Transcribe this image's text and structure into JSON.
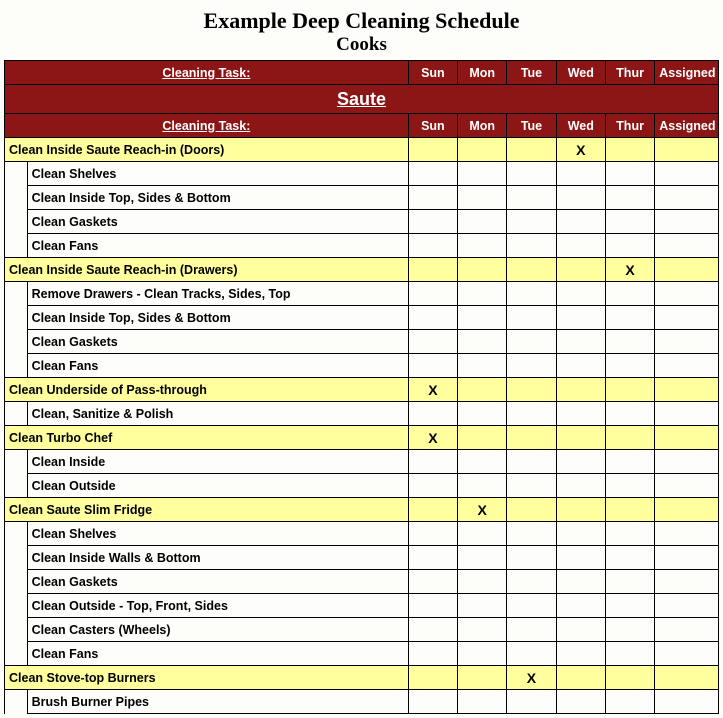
{
  "title": "Example Deep Cleaning Schedule",
  "subtitle": "Cooks",
  "columns": {
    "task": "Cleaning Task:",
    "sun": "Sun",
    "mon": "Mon",
    "tue": "Tue",
    "wed": "Wed",
    "thur": "Thur",
    "assigned": "Assigned"
  },
  "section": "Saute",
  "rows": [
    {
      "type": "main",
      "label": "Clean Inside Saute Reach-in (Doors)",
      "marks": {
        "wed": "X"
      }
    },
    {
      "type": "sub",
      "label": "Clean Shelves"
    },
    {
      "type": "sub",
      "label": "Clean Inside Top, Sides & Bottom"
    },
    {
      "type": "sub",
      "label": "Clean Gaskets"
    },
    {
      "type": "sub",
      "label": "Clean Fans"
    },
    {
      "type": "main",
      "label": "Clean Inside Saute Reach-in (Drawers)",
      "marks": {
        "thur": "X"
      }
    },
    {
      "type": "sub",
      "label": "Remove Drawers - Clean Tracks, Sides, Top"
    },
    {
      "type": "sub",
      "label": "Clean Inside Top, Sides & Bottom"
    },
    {
      "type": "sub",
      "label": "Clean Gaskets"
    },
    {
      "type": "sub",
      "label": "Clean Fans"
    },
    {
      "type": "main",
      "label": "Clean Underside of Pass-through",
      "marks": {
        "sun": "X"
      }
    },
    {
      "type": "sub",
      "label": "Clean, Sanitize & Polish"
    },
    {
      "type": "main",
      "label": "Clean Turbo Chef",
      "marks": {
        "sun": "X"
      }
    },
    {
      "type": "sub",
      "label": "Clean Inside"
    },
    {
      "type": "sub",
      "label": "Clean Outside"
    },
    {
      "type": "main",
      "label": "Clean Saute Slim Fridge",
      "marks": {
        "mon": "X"
      }
    },
    {
      "type": "sub",
      "label": "Clean Shelves"
    },
    {
      "type": "sub",
      "label": "Clean Inside Walls & Bottom"
    },
    {
      "type": "sub",
      "label": "Clean Gaskets"
    },
    {
      "type": "sub",
      "label": "Clean Outside - Top, Front, Sides"
    },
    {
      "type": "sub",
      "label": "Clean Casters (Wheels)"
    },
    {
      "type": "sub",
      "label": "Clean Fans"
    },
    {
      "type": "main",
      "label": "Clean Stove-top Burners",
      "marks": {
        "tue": "X"
      }
    },
    {
      "type": "sub",
      "label": "Brush Burner Pipes"
    }
  ]
}
